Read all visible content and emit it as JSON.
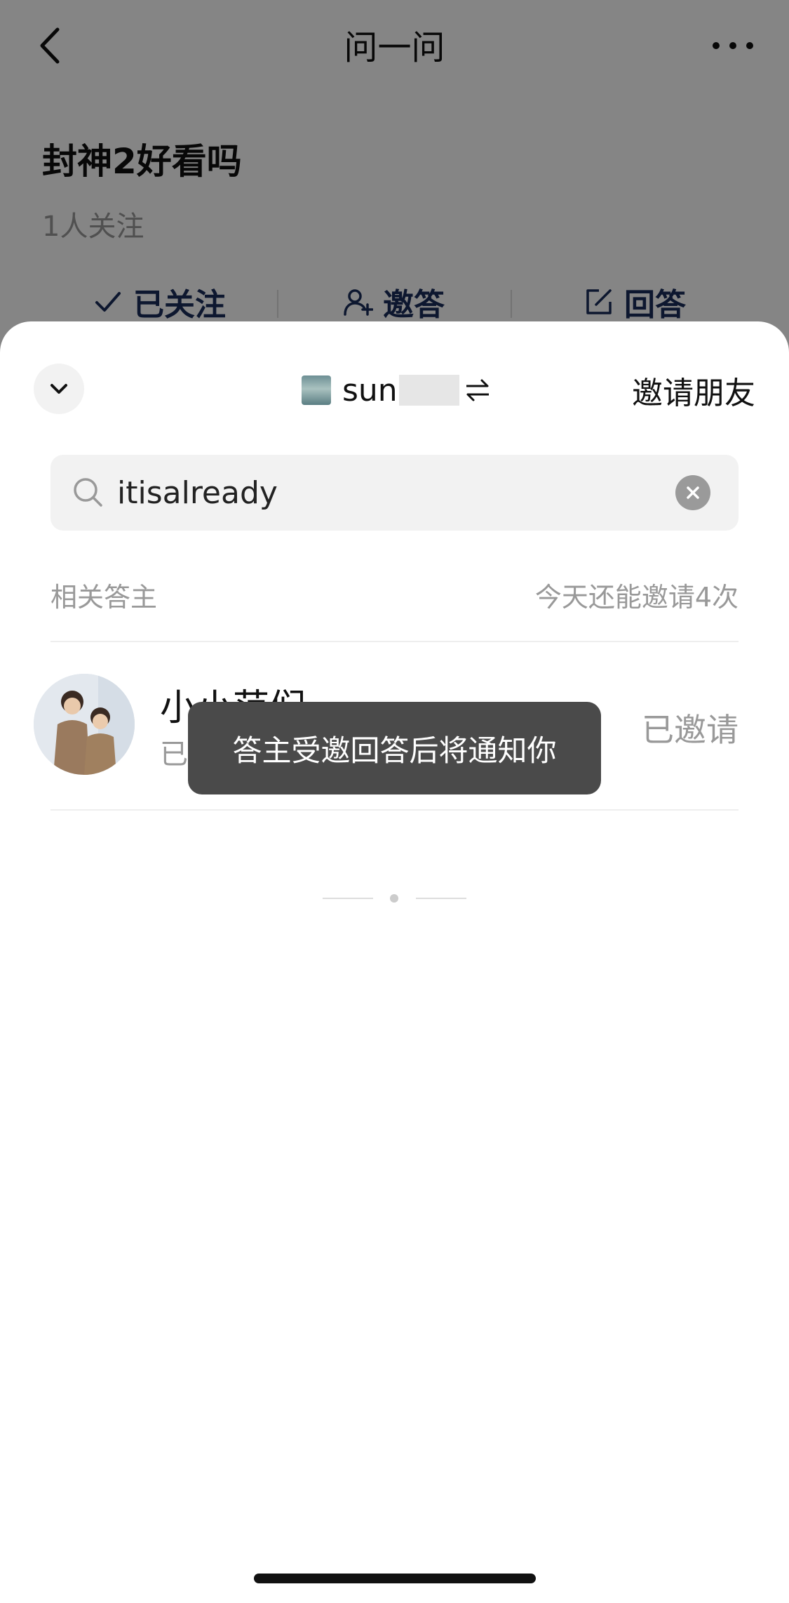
{
  "header": {
    "title": "问一问"
  },
  "question": {
    "title": "封神2好看吗",
    "followers": "1人关注",
    "actions": {
      "follow_label": "已关注",
      "invite_label": "邀答",
      "answer_label": "回答"
    }
  },
  "sheet": {
    "account_name": "sun",
    "invite_friends_label": "邀请朋友",
    "search": {
      "value": "itisalready"
    },
    "section_label": "相关答主",
    "quota_text": "今天还能邀请4次",
    "results": [
      {
        "name": "小小范们",
        "subtitle": "已",
        "status": "已邀请"
      }
    ]
  },
  "toast": {
    "text": "答主受邀回答后将通知你"
  },
  "icons": {
    "back": "chevron-left-icon",
    "more": "more-icon",
    "follow": "check-icon",
    "invite": "add-user-icon",
    "answer": "edit-icon",
    "collapse": "chevron-down-icon",
    "switch": "switch-account-icon",
    "search": "search-icon",
    "clear": "clear-icon"
  },
  "colors": {
    "action_text": "#1a2c5a",
    "toast_bg": "#4a4a4a",
    "muted_text": "#999999"
  }
}
